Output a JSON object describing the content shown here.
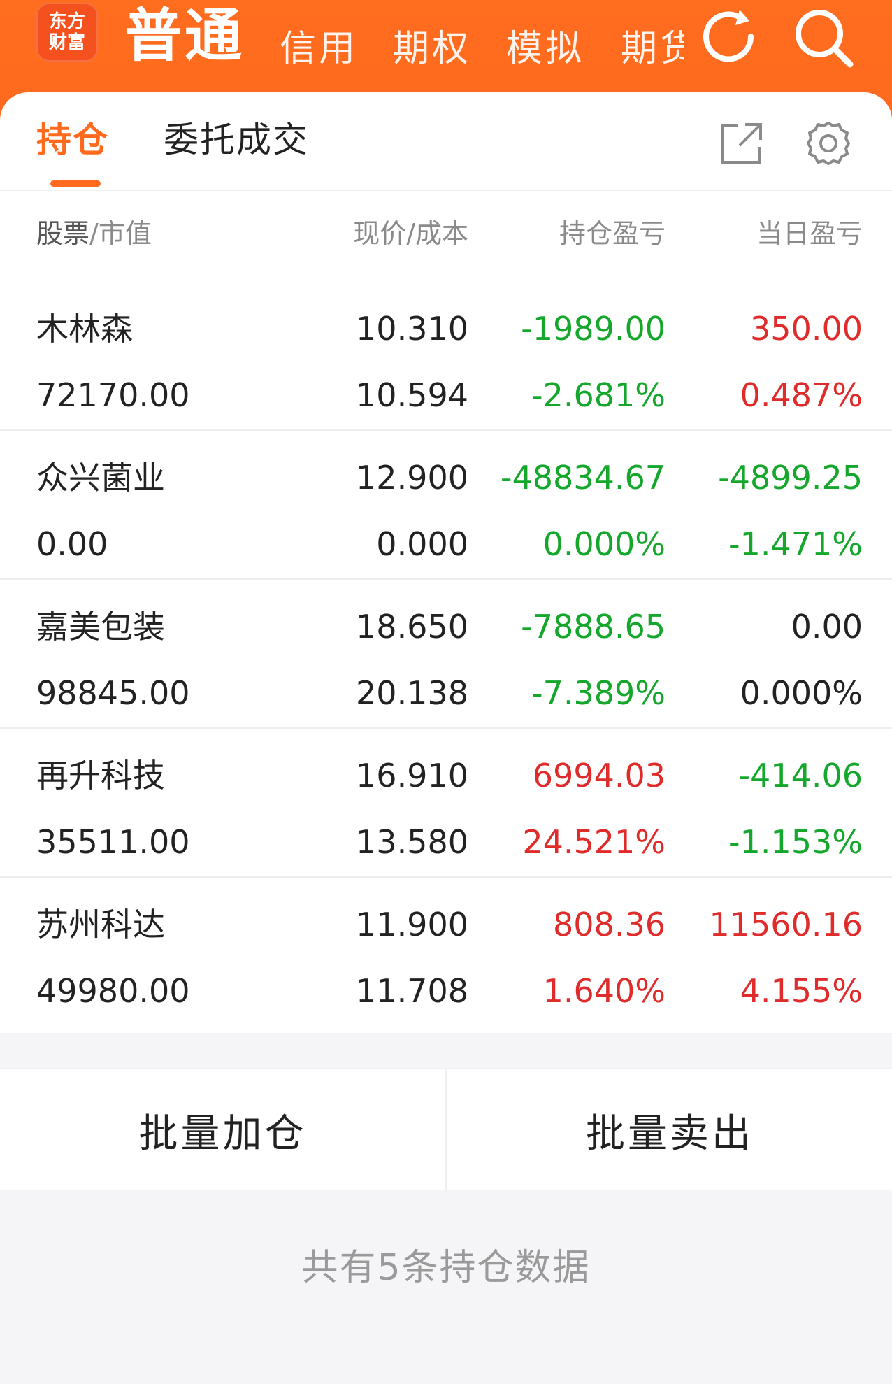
{
  "app": {
    "logo_line1": "东方",
    "logo_line2": "财富"
  },
  "topnav": {
    "active": "普通",
    "items": [
      "信用",
      "期权",
      "模拟",
      "期货"
    ]
  },
  "tabs": {
    "positions": "持仓",
    "orders": "委托成交"
  },
  "table": {
    "headers": {
      "name": "股票",
      "name_sub": "/市值",
      "price": "现价/成本",
      "pos_pl": "持仓盈亏",
      "day_pl": "当日盈亏"
    },
    "rows": [
      {
        "name": "木林森",
        "market_value": "72170.00",
        "price": "10.310",
        "cost": "10.594",
        "pos_pl": "-1989.00",
        "pos_pl_pct": "-2.681%",
        "day_pl": "350.00",
        "day_pl_pct": "0.487%",
        "pos_color": "green",
        "day_color": "red"
      },
      {
        "name": "众兴菌业",
        "market_value": "0.00",
        "price": "12.900",
        "cost": "0.000",
        "pos_pl": "-48834.67",
        "pos_pl_pct": "0.000%",
        "day_pl": "-4899.25",
        "day_pl_pct": "-1.471%",
        "pos_color": "green",
        "day_color": "green"
      },
      {
        "name": "嘉美包装",
        "market_value": "98845.00",
        "price": "18.650",
        "cost": "20.138",
        "pos_pl": "-7888.65",
        "pos_pl_pct": "-7.389%",
        "day_pl": "0.00",
        "day_pl_pct": "0.000%",
        "pos_color": "green",
        "day_color": "dark"
      },
      {
        "name": "再升科技",
        "market_value": "35511.00",
        "price": "16.910",
        "cost": "13.580",
        "pos_pl": "6994.03",
        "pos_pl_pct": "24.521%",
        "day_pl": "-414.06",
        "day_pl_pct": "-1.153%",
        "pos_color": "red",
        "day_color": "green"
      },
      {
        "name": "苏州科达",
        "market_value": "49980.00",
        "price": "11.900",
        "cost": "11.708",
        "pos_pl": "808.36",
        "pos_pl_pct": "1.640%",
        "day_pl": "11560.16",
        "day_pl_pct": "4.155%",
        "pos_color": "red",
        "day_color": "red"
      }
    ]
  },
  "buttons": {
    "batch_add": "批量加仓",
    "batch_sell": "批量卖出"
  },
  "footer": {
    "summary": "共有5条持仓数据"
  },
  "colors": {
    "brand_orange": "#ff6a1e",
    "profit_red": "#e02b2b",
    "loss_green": "#14a72b"
  }
}
